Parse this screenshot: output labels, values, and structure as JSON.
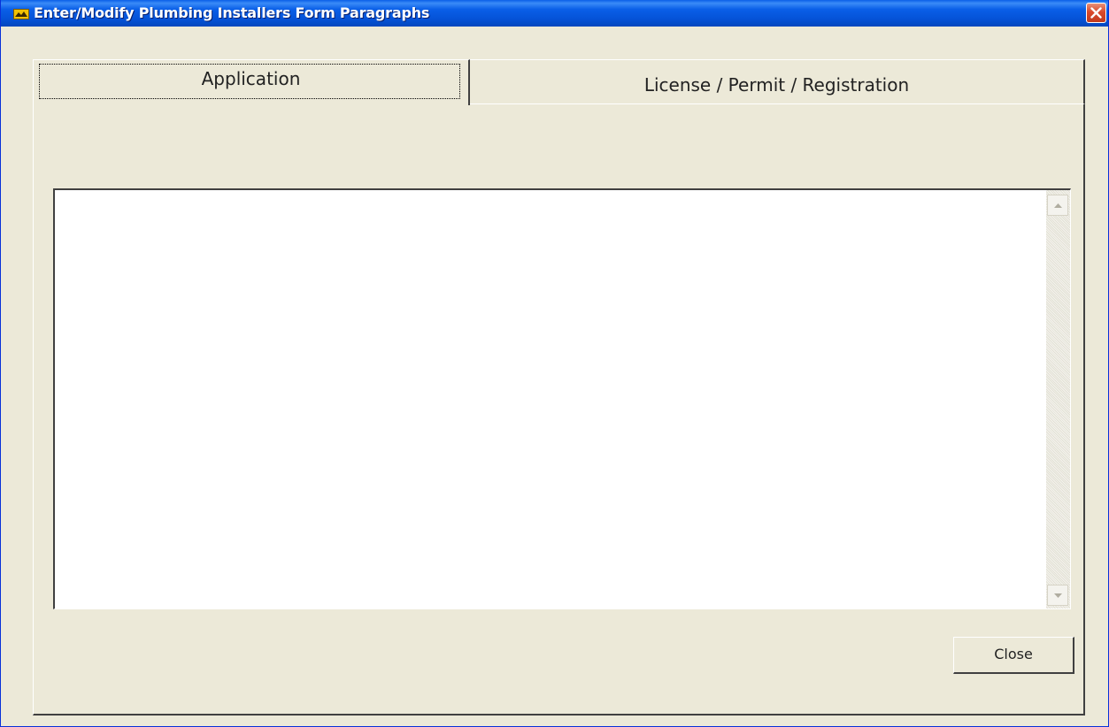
{
  "window": {
    "title": "Enter/Modify Plumbing Installers Form Paragraphs",
    "icon": "app-icon",
    "close_icon": "close-icon"
  },
  "tabs": [
    {
      "label": "Application",
      "selected": true
    },
    {
      "label": "License / Permit / Registration",
      "selected": false
    }
  ],
  "memo": {
    "value": "",
    "scroll_up_icon": "scroll-up-arrow-icon",
    "scroll_down_icon": "scroll-down-arrow-icon"
  },
  "buttons": {
    "close_label": "Close"
  },
  "colors": {
    "titlebar": "#0A5FE8",
    "face": "#ECE9D8",
    "close_button": "#DA4A2B"
  }
}
